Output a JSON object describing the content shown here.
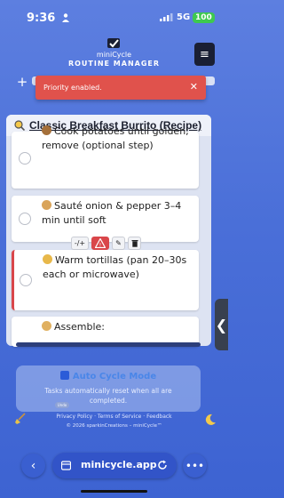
{
  "status_bar": {
    "time": "9:36",
    "network": "5G",
    "battery": "100"
  },
  "header": {
    "logo_name": "miniCycle",
    "logo_subtitle": "ROUTINE MANAGER",
    "menu_icon": "≡"
  },
  "toolbar_top": {
    "add_label": "+"
  },
  "toast": {
    "message": "Priority enabled.",
    "close_label": "✕"
  },
  "panel": {
    "title": "Classic Breakfast Burrito (Recipe)",
    "tasks": [
      {
        "text": "Cook potatoes until golden; remove (optional step)",
        "emoji": "potato-icon"
      },
      {
        "text": "Sauté onion & pepper 3–4 min until soft",
        "emoji": "onion-icon"
      },
      {
        "text": "Warm tortillas (pan 20–30s each or microwave)",
        "emoji": "taco-icon",
        "priority": true
      },
      {
        "text": "Assemble:",
        "emoji": "burrito-icon"
      }
    ]
  },
  "task_actions": {
    "move_label": "-/+",
    "priority_label": "!",
    "edit_label": "✎",
    "delete_label": "🗑"
  },
  "auto_cycle": {
    "title": "Auto Cycle Mode",
    "description": "Tasks automatically reset when all are completed.",
    "toggle_label": "Undo"
  },
  "footer": {
    "links": "Privacy Policy · Terms of Service · Feedback",
    "copyright": "© 2026 sparkinCreations – miniCycle™"
  },
  "bottom_bar": {
    "back_label": "‹",
    "url": "minicycle.app",
    "more_label": "•••"
  },
  "side_handle_label": "❮",
  "colors": {
    "background": "#4a6fd8",
    "toast": "#e0524c",
    "priority": "#d9464a",
    "accent": "#4a86e8"
  }
}
